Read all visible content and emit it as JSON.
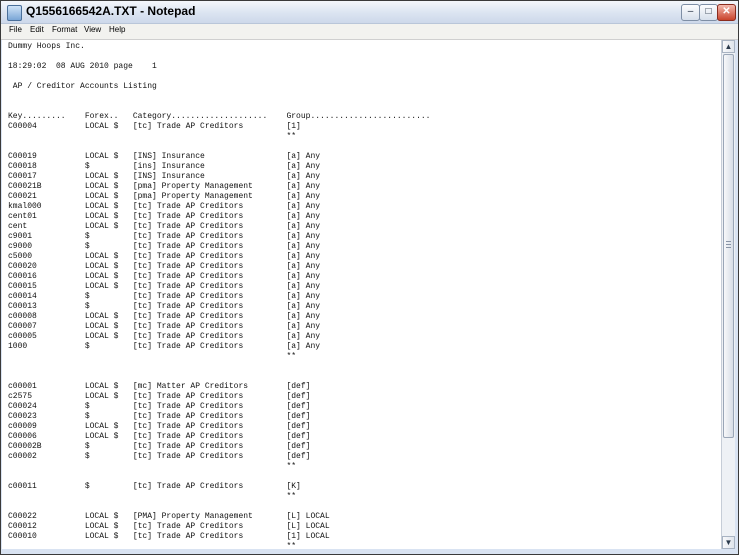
{
  "window": {
    "title": "Q1556166542A.TXT - Notepad",
    "controls": {
      "minimize": "–",
      "maximize": "□",
      "close": "✕"
    }
  },
  "menu": [
    "File",
    "Edit",
    "Format",
    "View",
    "Help"
  ],
  "document": {
    "lines": [
      "Dummy Hoops Inc.",
      "",
      "18:29:02  08 AUG 2010 page    1",
      "",
      " AP / Creditor Accounts Listing",
      "",
      "",
      "Key.........    Forex..   Category....................    Group.........................",
      "C00004          LOCAL $   [tc] Trade AP Creditors         [1]",
      "                                                          **",
      "",
      "C00019          LOCAL $   [INS] Insurance                 [a] Any",
      "C00018          $         [ins] Insurance                 [a] Any",
      "C00017          LOCAL $   [INS] Insurance                 [a] Any",
      "C00021B         LOCAL $   [pma] Property Management       [a] Any",
      "C00021          LOCAL $   [pma] Property Management       [a] Any",
      "kmal000         LOCAL $   [tc] Trade AP Creditors         [a] Any",
      "cent01          LOCAL $   [tc] Trade AP Creditors         [a] Any",
      "cent            LOCAL $   [tc] Trade AP Creditors         [a] Any",
      "c9001           $         [tc] Trade AP Creditors         [a] Any",
      "c9000           $         [tc] Trade AP Creditors         [a] Any",
      "c5000           LOCAL $   [tc] Trade AP Creditors         [a] Any",
      "C00020          LOCAL $   [tc] Trade AP Creditors         [a] Any",
      "C00016          LOCAL $   [tc] Trade AP Creditors         [a] Any",
      "C00015          LOCAL $   [tc] Trade AP Creditors         [a] Any",
      "c00014          $         [tc] Trade AP Creditors         [a] Any",
      "C00013          $         [tc] Trade AP Creditors         [a] Any",
      "c00008          LOCAL $   [tc] Trade AP Creditors         [a] Any",
      "C00007          LOCAL $   [tc] Trade AP Creditors         [a] Any",
      "c00005          LOCAL $   [tc] Trade AP Creditors         [a] Any",
      "1000            $         [tc] Trade AP Creditors         [a] Any",
      "                                                          **",
      "",
      "",
      "c00001          LOCAL $   [mc] Matter AP Creditors        [def]",
      "c2575           LOCAL $   [tc] Trade AP Creditors         [def]",
      "C00024          $         [tc] Trade AP Creditors         [def]",
      "C00023          $         [tc] Trade AP Creditors         [def]",
      "c00009          LOCAL $   [tc] Trade AP Creditors         [def]",
      "C00006          LOCAL $   [tc] Trade AP Creditors         [def]",
      "C00002B         $         [tc] Trade AP Creditors         [def]",
      "c00002          $         [tc] Trade AP Creditors         [def]",
      "                                                          **",
      "",
      "c00011          $         [tc] Trade AP Creditors         [K]",
      "                                                          **",
      "",
      "C00022          LOCAL $   [PMA] Property Management       [L] LOCAL",
      "C00012          LOCAL $   [tc] Trade AP Creditors         [L] LOCAL",
      "C00010          LOCAL $   [tc] Trade AP Creditors         [1] LOCAL",
      "                                                          **"
    ]
  },
  "scrollbar": {
    "up": "▲",
    "down": "▼"
  }
}
